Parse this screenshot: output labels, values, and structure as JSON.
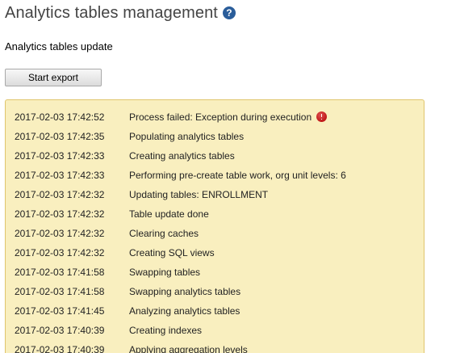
{
  "header": {
    "title": "Analytics tables management",
    "help_icon": "help-icon",
    "help_glyph": "?"
  },
  "section": {
    "label": "Analytics tables update"
  },
  "actions": {
    "start_export_label": "Start export"
  },
  "colors": {
    "log_background": "#f9efbf",
    "log_border": "#e0c56c",
    "help_icon": "#2a5d9a",
    "error_icon": "#b10000"
  },
  "log": {
    "entries": [
      {
        "time": "2017-02-03 17:42:52",
        "message": "Process failed: Exception during execution",
        "icon": "error-icon"
      },
      {
        "time": "2017-02-03 17:42:35",
        "message": "Populating analytics tables"
      },
      {
        "time": "2017-02-03 17:42:33",
        "message": "Creating analytics tables"
      },
      {
        "time": "2017-02-03 17:42:33",
        "message": "Performing pre-create table work, org unit levels: 6"
      },
      {
        "time": "2017-02-03 17:42:32",
        "message": "Updating tables: ENROLLMENT"
      },
      {
        "time": "2017-02-03 17:42:32",
        "message": "Table update done"
      },
      {
        "time": "2017-02-03 17:42:32",
        "message": "Clearing caches"
      },
      {
        "time": "2017-02-03 17:42:32",
        "message": "Creating SQL views"
      },
      {
        "time": "2017-02-03 17:41:58",
        "message": "Swapping tables"
      },
      {
        "time": "2017-02-03 17:41:58",
        "message": "Swapping analytics tables"
      },
      {
        "time": "2017-02-03 17:41:45",
        "message": "Analyzing analytics tables"
      },
      {
        "time": "2017-02-03 17:40:39",
        "message": "Creating indexes"
      },
      {
        "time": "2017-02-03 17:40:39",
        "message": "Applying aggregation levels"
      }
    ]
  }
}
